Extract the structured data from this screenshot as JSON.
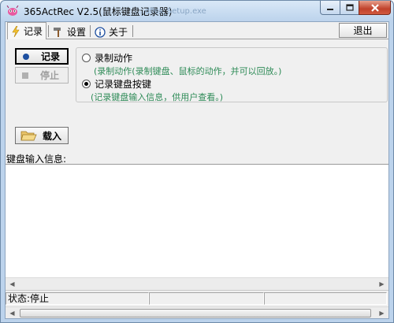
{
  "window": {
    "title": "365ActRec V2.5(鼠标键盘记录器)",
    "background_title": "....dfiss_Setup.exe"
  },
  "tabs": [
    {
      "label": "记录",
      "icon": "lightning-icon",
      "active": true
    },
    {
      "label": "设置",
      "icon": "hammer-icon",
      "active": false
    },
    {
      "label": "关于",
      "icon": "info-icon",
      "active": false
    }
  ],
  "toolbar": {
    "exit_label": "退出"
  },
  "actions": {
    "record_label": "记录",
    "stop_label": "停止",
    "load_label": "载入"
  },
  "mode": {
    "options": [
      {
        "label": "录制动作",
        "description": "(录制动作(录制键盘、鼠标的动作，并可以回放。)",
        "selected": false
      },
      {
        "label": "记录键盘按键",
        "description": "(记录键盘输入信息，供用户查看。)",
        "selected": true
      }
    ]
  },
  "keyboard": {
    "label": "键盘输入信息:",
    "content": ""
  },
  "status": {
    "text": "状态:停止"
  },
  "colors": {
    "accent_text": "#2e8b57",
    "title_bar": "#bcd3ec",
    "close_button": "#c0412b"
  }
}
